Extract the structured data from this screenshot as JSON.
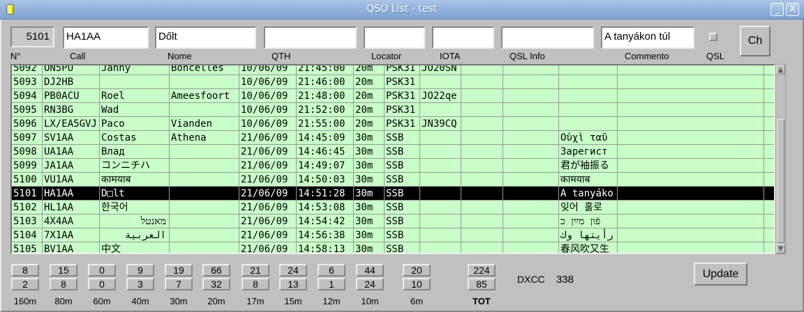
{
  "window": {
    "title": "QSO List - test",
    "minimize": "_",
    "close": "X"
  },
  "form": {
    "number": "5101",
    "call": "HA1AA",
    "name": "Dőlt",
    "qth": "",
    "locator": "",
    "iota": "",
    "qsl_info": "",
    "comment": "A tanyákon túl",
    "qsl_checked": false,
    "ch_label": "Ch"
  },
  "headers": [
    "N°",
    "Call",
    "Nome",
    "QTH",
    "Locator",
    "IOTA",
    "QSL Info",
    "Commento",
    "QSL"
  ],
  "rows": [
    [
      "5092",
      "ON5PU",
      "Janny",
      "Boncelles",
      "10/06/09",
      "21:45:00",
      "20m",
      "PSK31",
      "JO20SN",
      "",
      "",
      "",
      ""
    ],
    [
      "5093",
      "DJ2HB",
      "",
      "",
      "10/06/09",
      "21:46:00",
      "20m",
      "PSK31",
      "",
      "",
      "",
      "",
      ""
    ],
    [
      "5094",
      "PB0ACU",
      "Roel",
      "Ameesfoort",
      "10/06/09",
      "21:48:00",
      "20m",
      "PSK31",
      "JO22qe",
      "",
      "",
      "",
      ""
    ],
    [
      "5095",
      "RN3BG",
      "Wad",
      "",
      "10/06/09",
      "21:52:00",
      "20m",
      "PSK31",
      "",
      "",
      "",
      "",
      ""
    ],
    [
      "5096",
      "LX/EA5GVJ",
      "Paco",
      "Vianden",
      "10/06/09",
      "21:55:00",
      "20m",
      "PSK31",
      "JN39CQ",
      "",
      "",
      "",
      ""
    ],
    [
      "5097",
      "SV1AA",
      "Costas",
      "Athena",
      "21/06/09",
      "14:45:09",
      "30m",
      "SSB",
      "",
      "",
      "",
      " Οὐχὶ ταῦ",
      ""
    ],
    [
      "5098",
      "UA1AA",
      "Влад",
      "",
      "21/06/09",
      "14:46:45",
      "30m",
      "SSB",
      "",
      "",
      "",
      " Зарегист",
      ""
    ],
    [
      "5099",
      "JA1AA",
      "コンニチハ",
      "",
      "21/06/09",
      "14:49:07",
      "30m",
      "SSB",
      "",
      "",
      "",
      "君が袖振る",
      ""
    ],
    [
      "5100",
      "VU1AA",
      "कामयाब",
      "",
      "21/06/09",
      "14:50:03",
      "30m",
      "SSB",
      "",
      "",
      "",
      "कामयाब",
      ""
    ],
    [
      "5101",
      "HA1AA",
      "D□lt",
      "",
      "21/06/09",
      "14:51:28",
      "30m",
      "SSB",
      "",
      "",
      "",
      "A tanyáko",
      ""
    ],
    [
      "5102",
      "HL1AA",
      "한국어",
      "",
      "21/06/09",
      "14:53:08",
      "30m",
      "SSB",
      "",
      "",
      "",
      "잊어 홀로 ",
      ""
    ],
    [
      "5103",
      "4X4AA",
      "מאנטל",
      "",
      "21/06/09",
      "14:54:42",
      "30m",
      "SSB",
      "",
      "",
      "",
      "פֿון מײַן כ",
      ""
    ],
    [
      "5104",
      "7X1AA",
      "العربية",
      "",
      "21/06/09",
      "14:56:38",
      "30m",
      "SSB",
      "",
      "",
      "",
      "رأيتها وك",
      ""
    ],
    [
      "5105",
      "BV1AA",
      "中文",
      "",
      "21/06/09",
      "14:58:13",
      "30m",
      "SSB",
      "",
      "",
      "",
      "春风吹又生",
      ""
    ]
  ],
  "selected_row": "5101",
  "stats": [
    {
      "band": "160m",
      "top": "8",
      "bottom": "2"
    },
    {
      "band": "80m",
      "top": "15",
      "bottom": "8"
    },
    {
      "band": "60m",
      "top": "0",
      "bottom": "0"
    },
    {
      "band": "40m",
      "top": "9",
      "bottom": "3"
    },
    {
      "band": "30m",
      "top": "19",
      "bottom": "7"
    },
    {
      "band": "20m",
      "top": "66",
      "bottom": "32"
    },
    {
      "band": "17m",
      "top": "21",
      "bottom": "8"
    },
    {
      "band": "15m",
      "top": "24",
      "bottom": "13"
    },
    {
      "band": "12m",
      "top": "6",
      "bottom": "1"
    },
    {
      "band": "10m",
      "top": "44",
      "bottom": "24"
    },
    {
      "band": "6m",
      "top": "20",
      "bottom": "10"
    },
    {
      "band": "TOT",
      "top": "224",
      "bottom": "85"
    }
  ],
  "dxcc": {
    "label": "DXCC",
    "value": "338"
  },
  "update_label": "Update"
}
